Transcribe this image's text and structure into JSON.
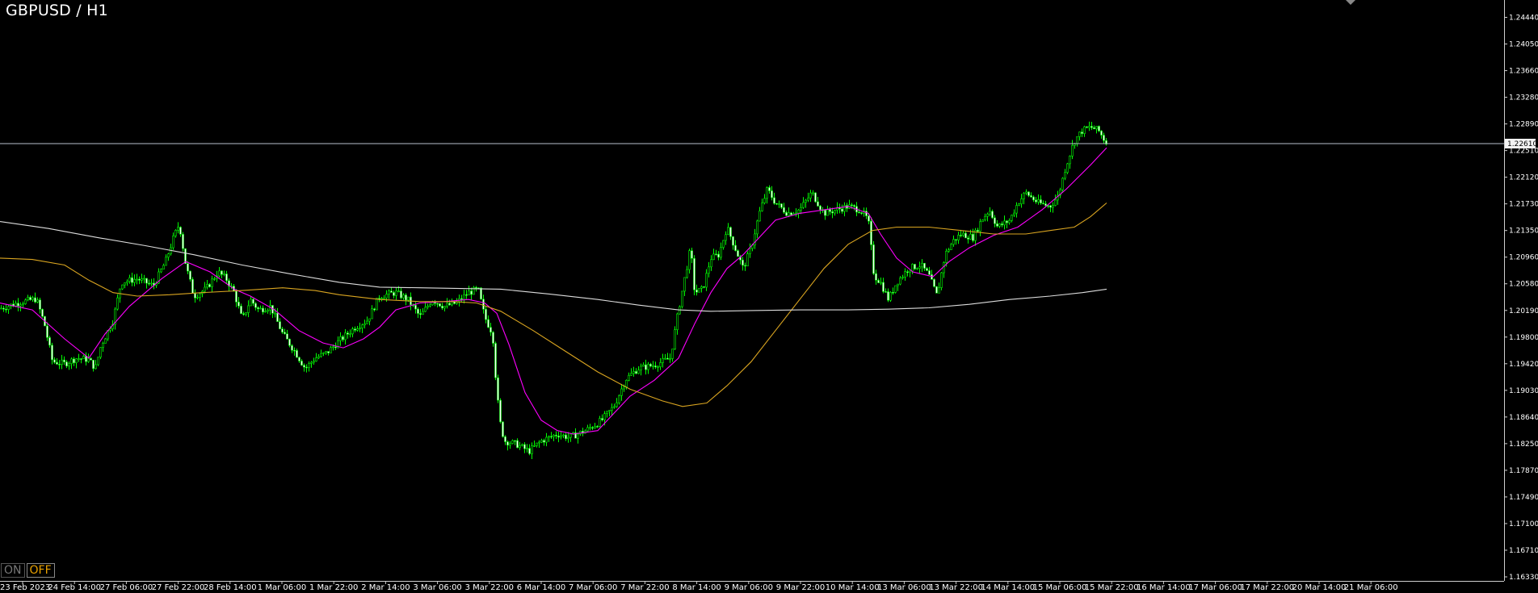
{
  "window": {
    "title": "GBPUSD / H1"
  },
  "toggle": {
    "on_label": "ON",
    "off_label": "OFF"
  },
  "chart_data": {
    "type": "candlestick",
    "symbol": "GBPUSD",
    "timeframe": "H1",
    "ylim": [
      1.1633,
      1.2444
    ],
    "y_ticks": [
      "1.24440",
      "1.24050",
      "1.23660",
      "1.23280",
      "1.22890",
      "1.22510",
      "1.22120",
      "1.21730",
      "1.21350",
      "1.20960",
      "1.20580",
      "1.20190",
      "1.19800",
      "1.19420",
      "1.19030",
      "1.18640",
      "1.18250",
      "1.17870",
      "1.17490",
      "1.17100",
      "1.16710",
      "1.16330"
    ],
    "x_ticks": [
      "23 Feb 2023",
      "24 Feb 14:00",
      "27 Feb 06:00",
      "27 Feb 22:00",
      "28 Feb 14:00",
      "1 Mar 06:00",
      "1 Mar 22:00",
      "2 Mar 14:00",
      "3 Mar 06:00",
      "3 Mar 22:00",
      "6 Mar 14:00",
      "7 Mar 06:00",
      "7 Mar 22:00",
      "8 Mar 14:00",
      "9 Mar 06:00",
      "9 Mar 22:00",
      "10 Mar 14:00",
      "13 Mar 06:00",
      "13 Mar 22:00",
      "14 Mar 14:00",
      "15 Mar 06:00",
      "15 Mar 22:00",
      "16 Mar 14:00",
      "17 Mar 06:00",
      "17 Mar 22:00",
      "20 Mar 14:00",
      "21 Mar 06:00"
    ],
    "current_price": "1.22610",
    "price_path": [
      [
        0,
        1.2022
      ],
      [
        25,
        1.2031
      ],
      [
        45,
        1.2036
      ],
      [
        55,
        1.2
      ],
      [
        65,
        1.1945
      ],
      [
        80,
        1.1942
      ],
      [
        95,
        1.195
      ],
      [
        110,
        1.1948
      ],
      [
        118,
        1.1935
      ],
      [
        125,
        1.1968
      ],
      [
        140,
        1.2005
      ],
      [
        150,
        1.206
      ],
      [
        170,
        1.2065
      ],
      [
        190,
        1.2055
      ],
      [
        205,
        1.209
      ],
      [
        215,
        1.2125
      ],
      [
        222,
        1.2145
      ],
      [
        230,
        1.2085
      ],
      [
        240,
        1.204
      ],
      [
        255,
        1.205
      ],
      [
        270,
        1.2075
      ],
      [
        280,
        1.2065
      ],
      [
        290,
        1.2045
      ],
      [
        300,
        1.2005
      ],
      [
        310,
        1.2035
      ],
      [
        320,
        1.202
      ],
      [
        335,
        1.2025
      ],
      [
        350,
        1.1985
      ],
      [
        365,
        1.196
      ],
      [
        378,
        1.1935
      ],
      [
        390,
        1.195
      ],
      [
        405,
        1.1958
      ],
      [
        420,
        1.1975
      ],
      [
        440,
        1.1995
      ],
      [
        455,
        1.2005
      ],
      [
        470,
        1.204
      ],
      [
        490,
        1.2045
      ],
      [
        505,
        1.2035
      ],
      [
        520,
        1.201
      ],
      [
        535,
        1.2035
      ],
      [
        550,
        1.2025
      ],
      [
        565,
        1.203
      ],
      [
        580,
        1.2045
      ],
      [
        592,
        1.205
      ],
      [
        600,
        1.201
      ],
      [
        610,
        1.1985
      ],
      [
        615,
        1.19
      ],
      [
        620,
        1.185
      ],
      [
        625,
        1.183
      ],
      [
        640,
        1.1825
      ],
      [
        655,
        1.1815
      ],
      [
        670,
        1.183
      ],
      [
        690,
        1.184
      ],
      [
        705,
        1.1835
      ],
      [
        725,
        1.1845
      ],
      [
        745,
        1.186
      ],
      [
        760,
        1.188
      ],
      [
        775,
        1.192
      ],
      [
        790,
        1.1935
      ],
      [
        810,
        1.194
      ],
      [
        830,
        1.195
      ],
      [
        840,
        1.202
      ],
      [
        850,
        1.208
      ],
      [
        855,
        1.211
      ],
      [
        860,
        1.2045
      ],
      [
        870,
        1.205
      ],
      [
        880,
        1.2095
      ],
      [
        890,
        1.21
      ],
      [
        900,
        1.214
      ],
      [
        910,
        1.211
      ],
      [
        920,
        1.208
      ],
      [
        930,
        1.211
      ],
      [
        940,
        1.216
      ],
      [
        950,
        1.2195
      ],
      [
        960,
        1.2175
      ],
      [
        975,
        1.216
      ],
      [
        990,
        1.2165
      ],
      [
        1005,
        1.219
      ],
      [
        1020,
        1.216
      ],
      [
        1035,
        1.2165
      ],
      [
        1050,
        1.217
      ],
      [
        1065,
        1.2165
      ],
      [
        1075,
        1.215
      ],
      [
        1082,
        1.207
      ],
      [
        1090,
        1.206
      ],
      [
        1100,
        1.2035
      ],
      [
        1110,
        1.206
      ],
      [
        1125,
        1.208
      ],
      [
        1140,
        1.2085
      ],
      [
        1150,
        1.207
      ],
      [
        1160,
        1.204
      ],
      [
        1170,
        1.21
      ],
      [
        1180,
        1.212
      ],
      [
        1190,
        1.213
      ],
      [
        1205,
        1.2125
      ],
      [
        1215,
        1.215
      ],
      [
        1225,
        1.2165
      ],
      [
        1235,
        1.214
      ],
      [
        1250,
        1.215
      ],
      [
        1260,
        1.2175
      ],
      [
        1270,
        1.219
      ],
      [
        1285,
        1.2175
      ],
      [
        1300,
        1.217
      ],
      [
        1310,
        1.2185
      ],
      [
        1320,
        1.223
      ],
      [
        1330,
        1.2265
      ],
      [
        1340,
        1.228
      ],
      [
        1350,
        1.2285
      ],
      [
        1360,
        1.228
      ],
      [
        1370,
        1.2261
      ]
    ],
    "series": [
      {
        "color": "#ff00ff",
        "values": [
          [
            0,
            1.203
          ],
          [
            40,
            1.202
          ],
          [
            80,
            1.1978
          ],
          [
            110,
            1.195
          ],
          [
            130,
            1.1985
          ],
          [
            160,
            1.2025
          ],
          [
            200,
            1.2065
          ],
          [
            230,
            1.209
          ],
          [
            260,
            1.2075
          ],
          [
            290,
            1.205
          ],
          [
            310,
            1.204
          ],
          [
            340,
            1.202
          ],
          [
            370,
            1.199
          ],
          [
            400,
            1.1972
          ],
          [
            425,
            1.1965
          ],
          [
            450,
            1.1978
          ],
          [
            470,
            1.1995
          ],
          [
            490,
            1.202
          ],
          [
            520,
            1.203
          ],
          [
            550,
            1.2032
          ],
          [
            580,
            1.2035
          ],
          [
            600,
            1.203
          ],
          [
            615,
            1.2015
          ],
          [
            630,
            1.197
          ],
          [
            650,
            1.19
          ],
          [
            670,
            1.186
          ],
          [
            690,
            1.1845
          ],
          [
            710,
            1.184
          ],
          [
            740,
            1.1845
          ],
          [
            760,
            1.187
          ],
          [
            780,
            1.1895
          ],
          [
            810,
            1.1918
          ],
          [
            840,
            1.195
          ],
          [
            860,
            1.2
          ],
          [
            880,
            1.2045
          ],
          [
            900,
            1.208
          ],
          [
            920,
            1.21
          ],
          [
            940,
            1.2125
          ],
          [
            960,
            1.215
          ],
          [
            990,
            1.216
          ],
          [
            1020,
            1.2165
          ],
          [
            1050,
            1.217
          ],
          [
            1075,
            1.216
          ],
          [
            1090,
            1.213
          ],
          [
            1110,
            1.2095
          ],
          [
            1130,
            1.2075
          ],
          [
            1155,
            1.2068
          ],
          [
            1175,
            1.209
          ],
          [
            1200,
            1.211
          ],
          [
            1230,
            1.2128
          ],
          [
            1260,
            1.214
          ],
          [
            1290,
            1.2165
          ],
          [
            1320,
            1.2195
          ],
          [
            1350,
            1.223
          ],
          [
            1370,
            1.2255
          ]
        ]
      },
      {
        "color": "#daa520",
        "values": [
          [
            0,
            1.2095
          ],
          [
            40,
            1.2093
          ],
          [
            80,
            1.2085
          ],
          [
            110,
            1.2063
          ],
          [
            140,
            1.2045
          ],
          [
            170,
            1.204
          ],
          [
            210,
            1.2042
          ],
          [
            250,
            1.2045
          ],
          [
            300,
            1.2048
          ],
          [
            350,
            1.2052
          ],
          [
            390,
            1.2048
          ],
          [
            420,
            1.2042
          ],
          [
            470,
            1.2035
          ],
          [
            520,
            1.2032
          ],
          [
            560,
            1.2032
          ],
          [
            590,
            1.203
          ],
          [
            620,
            1.2018
          ],
          [
            660,
            1.199
          ],
          [
            700,
            1.196
          ],
          [
            740,
            1.193
          ],
          [
            780,
            1.1905
          ],
          [
            820,
            1.1888
          ],
          [
            845,
            1.188
          ],
          [
            875,
            1.1885
          ],
          [
            900,
            1.191
          ],
          [
            930,
            1.1945
          ],
          [
            960,
            1.199
          ],
          [
            990,
            1.2035
          ],
          [
            1020,
            1.208
          ],
          [
            1050,
            1.2115
          ],
          [
            1080,
            1.2135
          ],
          [
            1110,
            1.214
          ],
          [
            1150,
            1.214
          ],
          [
            1190,
            1.2135
          ],
          [
            1230,
            1.213
          ],
          [
            1270,
            1.213
          ],
          [
            1300,
            1.2135
          ],
          [
            1330,
            1.214
          ],
          [
            1350,
            1.2155
          ],
          [
            1370,
            1.2175
          ]
        ]
      },
      {
        "color": "#dddddd",
        "values": [
          [
            0,
            1.2148
          ],
          [
            60,
            1.2138
          ],
          [
            120,
            1.2125
          ],
          [
            180,
            1.2113
          ],
          [
            240,
            1.21
          ],
          [
            300,
            1.2085
          ],
          [
            360,
            1.2072
          ],
          [
            420,
            1.206
          ],
          [
            470,
            1.2053
          ],
          [
            520,
            1.2052
          ],
          [
            570,
            1.2051
          ],
          [
            620,
            1.205
          ],
          [
            680,
            1.2043
          ],
          [
            740,
            1.2035
          ],
          [
            790,
            1.2027
          ],
          [
            840,
            1.202
          ],
          [
            880,
            1.2018
          ],
          [
            930,
            1.2019
          ],
          [
            990,
            1.202
          ],
          [
            1050,
            1.202
          ],
          [
            1100,
            1.2021
          ],
          [
            1150,
            1.2023
          ],
          [
            1200,
            1.2028
          ],
          [
            1250,
            1.2035
          ],
          [
            1300,
            1.204
          ],
          [
            1340,
            1.2045
          ],
          [
            1370,
            1.205
          ]
        ]
      }
    ]
  }
}
